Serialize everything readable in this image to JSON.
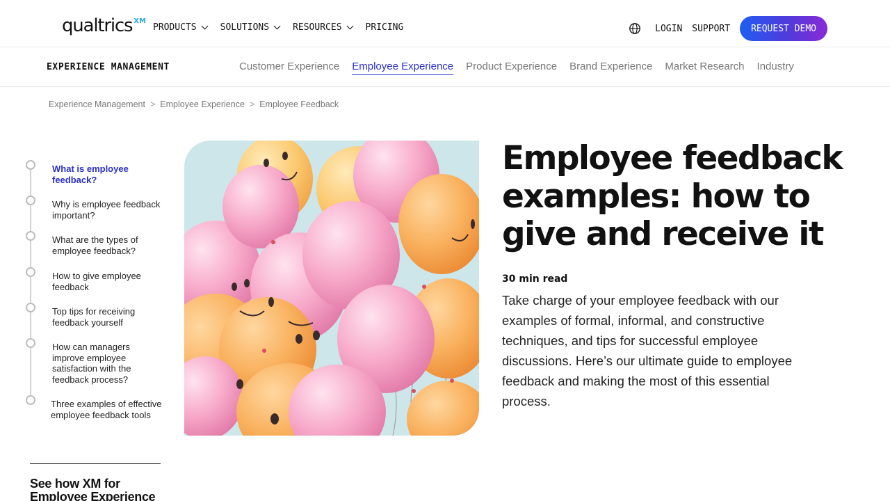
{
  "logo": {
    "text": "qualtrics",
    "superscript": "XM"
  },
  "nav": {
    "items": [
      {
        "label": "PRODUCTS",
        "has_dropdown": true
      },
      {
        "label": "SOLUTIONS",
        "has_dropdown": true
      },
      {
        "label": "RESOURCES",
        "has_dropdown": true
      },
      {
        "label": "PRICING",
        "has_dropdown": false
      }
    ],
    "globe_icon": "globe-icon",
    "login": "LOGIN",
    "support": "SUPPORT",
    "demo_button": "REQUEST DEMO"
  },
  "subnav": {
    "title": "EXPERIENCE MANAGEMENT",
    "links": [
      {
        "label": "Customer Experience",
        "active": false
      },
      {
        "label": "Employee Experience",
        "active": true
      },
      {
        "label": "Product Experience",
        "active": false
      },
      {
        "label": "Brand Experience",
        "active": false
      },
      {
        "label": "Market Research",
        "active": false
      },
      {
        "label": "Industry",
        "active": false
      }
    ]
  },
  "breadcrumb": {
    "items": [
      "Experience Management",
      "Employee Experience",
      "Employee Feedback"
    ],
    "separator": ">"
  },
  "toc": {
    "items": [
      {
        "label": "What is employee feedback?",
        "active": true
      },
      {
        "label": "Why is employee feedback important?",
        "active": false
      },
      {
        "label": "What are the types of employee feedback?",
        "active": false
      },
      {
        "label": "How to give employee feedback",
        "active": false
      },
      {
        "label": "Top tips for receiving feedback yourself",
        "active": false
      },
      {
        "label": "How can managers improve employee satisfaction with the feedback process?",
        "active": false
      },
      {
        "label": "Three examples of effective employee feedback tools",
        "active": false
      }
    ]
  },
  "cta": {
    "title": "See how XM for Employee Experience"
  },
  "article": {
    "title": "Employee feedback examples: how to give and receive it",
    "read_time": "30 min read",
    "intro": "Take charge of your employee feedback with our examples of formal, informal, and constructive techniques, and tips for successful employee discussions. Here’s our ultimate guide to employee feedback and making the most of this essential process."
  },
  "colors": {
    "accent": "#2a30c8",
    "demo_gradient_start": "#1f5ef0",
    "demo_gradient_end": "#8a2ad6",
    "logo_xm": "#2ba8e0"
  }
}
